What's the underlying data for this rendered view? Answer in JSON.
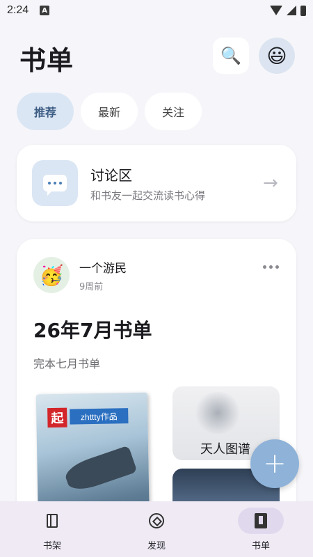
{
  "status_bar": {
    "time": "2:24",
    "notification_icon": "A"
  },
  "header": {
    "title": "书单",
    "search_icon": "🔍",
    "avatar": "😃"
  },
  "tabs": [
    {
      "label": "推荐",
      "active": true
    },
    {
      "label": "最新",
      "active": false
    },
    {
      "label": "关注",
      "active": false
    }
  ],
  "discussion": {
    "title": "讨论区",
    "subtitle": "和书友一起交流读书心得",
    "arrow": "→"
  },
  "book_list": {
    "user_avatar": "🥳",
    "username": "一个游民",
    "time": "9周前",
    "title": "26年7月书单",
    "description": "完本七月书单",
    "covers": [
      {
        "badge": "起",
        "brand": "zhttty作品"
      },
      {
        "title": "天人图谱"
      }
    ]
  },
  "fab": {
    "label": "+"
  },
  "bottom_nav": [
    {
      "label": "书架",
      "icon": "bookshelf-icon",
      "active": false
    },
    {
      "label": "发现",
      "icon": "compass-icon",
      "active": false
    },
    {
      "label": "书单",
      "icon": "booklist-icon",
      "active": true
    }
  ],
  "colors": {
    "accent": "#dbe6f4",
    "accent_text": "#3d5d84",
    "fab": "#8eb2d8",
    "nav_bg": "#efeaf4"
  }
}
